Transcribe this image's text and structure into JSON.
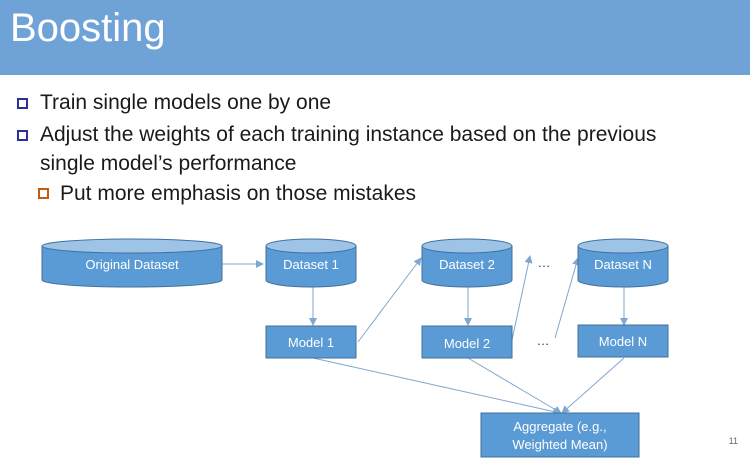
{
  "slide": {
    "title": "Boosting",
    "page_number": "11"
  },
  "bullets": {
    "b1": "Train single models one by one",
    "b2_line1": "Adjust the weights of each training instance based on the previous",
    "b2_line2": "single model’s performance",
    "sub1": "Put more emphasis on those mistakes"
  },
  "diagram": {
    "original_dataset": "Original Dataset",
    "dataset_1": "Dataset 1",
    "dataset_2": "Dataset 2",
    "dataset_n": "Dataset N",
    "model_1": "Model 1",
    "model_2": "Model 2",
    "model_n": "Model N",
    "ellipsis_top": "…",
    "ellipsis_mid": "…",
    "aggregate_line1": "Aggregate (e.g.,",
    "aggregate_line2": "Weighted Mean)"
  },
  "colors": {
    "title_bar": "#6fa3d8",
    "shape_fill": "#5b9bd5",
    "shape_border": "#41719c",
    "arrow": "#7fa7cf",
    "bullet_icon": "#2a2f9a",
    "sub_bullet_icon": "#c55a11"
  }
}
